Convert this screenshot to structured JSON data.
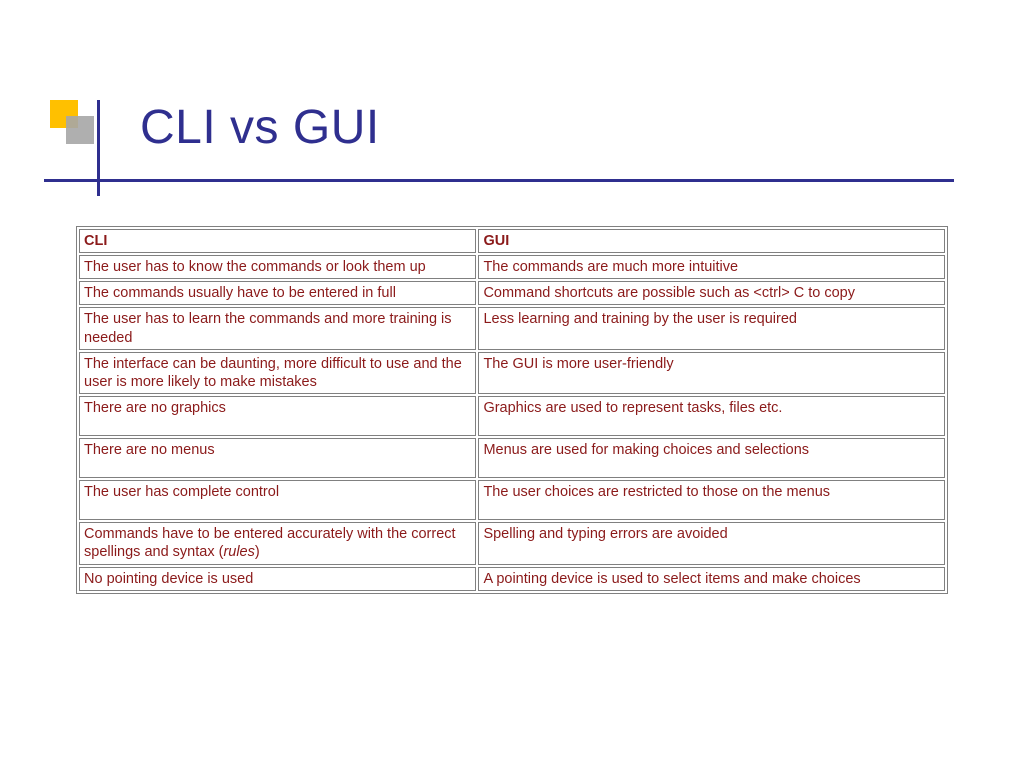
{
  "title": "CLI vs GUI",
  "table": {
    "headers": {
      "cli": "CLI",
      "gui": "GUI"
    },
    "rows": [
      {
        "cli": "The user has to know the commands or look them up",
        "gui": "The commands are much more intuitive"
      },
      {
        "cli": "The commands usually have to be entered in full",
        "gui": "Command shortcuts are possible such as <ctrl> C to copy"
      },
      {
        "cli": "The user has to learn the commands and more training is needed",
        "gui": "Less learning and training by the user is required"
      },
      {
        "cli": "The interface can be daunting, more difficult to use and the user is more likely to make mistakes",
        "gui": "The GUI is more user-friendly"
      },
      {
        "cli": "There are no graphics",
        "gui": "Graphics are used to represent tasks, files etc."
      },
      {
        "cli": "There are no menus",
        "gui": "Menus are used for making choices and selections"
      },
      {
        "cli": "The user has complete control",
        "gui": "The user choices are restricted to those on the menus"
      },
      {
        "cli_prefix": "Commands have to be entered accurately with the correct spellings and syntax (",
        "cli_em": "rules",
        "cli_suffix": ")",
        "gui": "Spelling and typing errors are avoided"
      },
      {
        "cli": "No pointing device is used",
        "gui": "A pointing device is used to select items and make choices"
      }
    ]
  }
}
